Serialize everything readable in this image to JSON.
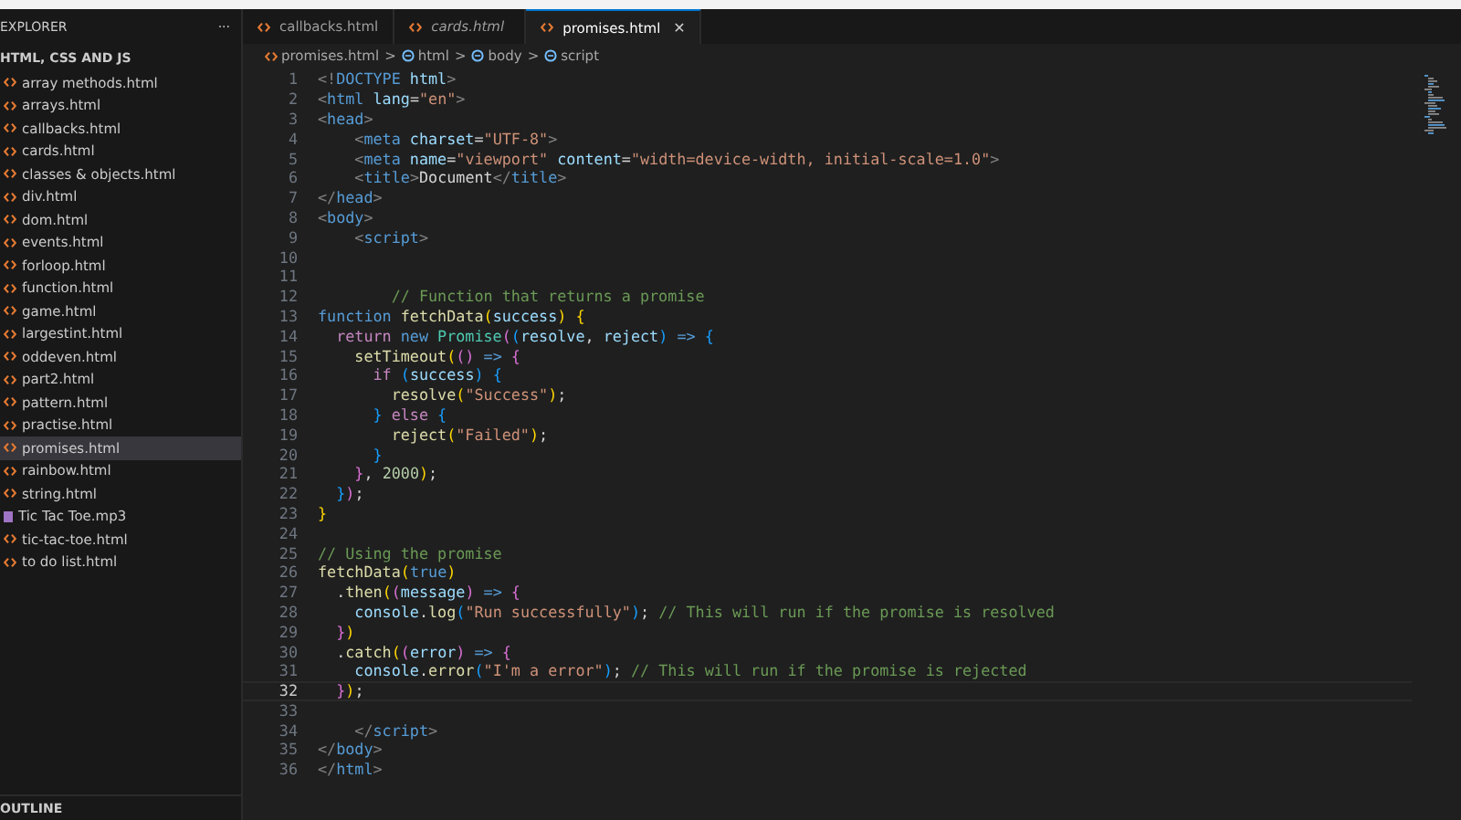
{
  "explorer": {
    "title": "EXPLORER",
    "more": "···",
    "folder": "HTML, CSS AND JS",
    "files": [
      {
        "name": "array methods.html",
        "kind": "html",
        "selected": false
      },
      {
        "name": "arrays.html",
        "kind": "html",
        "selected": false
      },
      {
        "name": "callbacks.html",
        "kind": "html",
        "selected": false
      },
      {
        "name": "cards.html",
        "kind": "html",
        "selected": false
      },
      {
        "name": "classes & objects.html",
        "kind": "html",
        "selected": false
      },
      {
        "name": "div.html",
        "kind": "html",
        "selected": false
      },
      {
        "name": "dom.html",
        "kind": "html",
        "selected": false
      },
      {
        "name": "events.html",
        "kind": "html",
        "selected": false
      },
      {
        "name": "forloop.html",
        "kind": "html",
        "selected": false
      },
      {
        "name": "function.html",
        "kind": "html",
        "selected": false
      },
      {
        "name": "game.html",
        "kind": "html",
        "selected": false
      },
      {
        "name": "largestint.html",
        "kind": "html",
        "selected": false
      },
      {
        "name": "oddeven.html",
        "kind": "html",
        "selected": false
      },
      {
        "name": "part2.html",
        "kind": "html",
        "selected": false
      },
      {
        "name": "pattern.html",
        "kind": "html",
        "selected": false
      },
      {
        "name": "practise.html",
        "kind": "html",
        "selected": false
      },
      {
        "name": "promises.html",
        "kind": "html",
        "selected": true
      },
      {
        "name": "rainbow.html",
        "kind": "html",
        "selected": false
      },
      {
        "name": "string.html",
        "kind": "html",
        "selected": false
      },
      {
        "name": "Tic Tac Toe.mp3",
        "kind": "audio",
        "selected": false
      },
      {
        "name": "tic-tac-toe.html",
        "kind": "html",
        "selected": false
      },
      {
        "name": "to do list.html",
        "kind": "html",
        "selected": false
      }
    ],
    "outline": "OUTLINE"
  },
  "tabs": [
    {
      "label": "callbacks.html",
      "selected": false,
      "preview": false
    },
    {
      "label": "cards.html",
      "selected": false,
      "preview": true
    },
    {
      "label": "promises.html",
      "selected": true,
      "preview": false,
      "close": "✕"
    }
  ],
  "breadcrumb": [
    {
      "label": "promises.html",
      "kind": "file"
    },
    {
      "label": "html",
      "kind": "element"
    },
    {
      "label": "body",
      "kind": "element"
    },
    {
      "label": "script",
      "kind": "element"
    }
  ],
  "breadcrumb_separator": ">",
  "code": [
    {
      "number": "1",
      "current": false,
      "tokens": [
        {
          "kind": "punct",
          "text": "<!"
        },
        {
          "kind": "tag",
          "text": "DOCTYPE"
        },
        {
          "kind": "attr",
          "text": " html"
        },
        {
          "kind": "punct",
          "text": ">"
        }
      ]
    },
    {
      "number": "2",
      "current": false,
      "tokens": [
        {
          "kind": "punct",
          "text": "<"
        },
        {
          "kind": "tag",
          "text": "html"
        },
        {
          "kind": "attr",
          "text": " lang"
        },
        {
          "kind": "text",
          "text": "="
        },
        {
          "kind": "str",
          "text": "\"en\""
        },
        {
          "kind": "punct",
          "text": ">"
        }
      ]
    },
    {
      "number": "3",
      "current": false,
      "tokens": [
        {
          "kind": "punct",
          "text": "<"
        },
        {
          "kind": "tag",
          "text": "head"
        },
        {
          "kind": "punct",
          "text": ">"
        }
      ]
    },
    {
      "number": "4",
      "current": false,
      "tokens": [
        {
          "kind": "punct",
          "text": "    <"
        },
        {
          "kind": "tag",
          "text": "meta"
        },
        {
          "kind": "attr",
          "text": " charset"
        },
        {
          "kind": "text",
          "text": "="
        },
        {
          "kind": "str",
          "text": "\"UTF-8\""
        },
        {
          "kind": "punct",
          "text": ">"
        }
      ]
    },
    {
      "number": "5",
      "current": false,
      "tokens": [
        {
          "kind": "punct",
          "text": "    <"
        },
        {
          "kind": "tag",
          "text": "meta"
        },
        {
          "kind": "attr",
          "text": " name"
        },
        {
          "kind": "text",
          "text": "="
        },
        {
          "kind": "str",
          "text": "\"viewport\""
        },
        {
          "kind": "attr",
          "text": " content"
        },
        {
          "kind": "text",
          "text": "="
        },
        {
          "kind": "str",
          "text": "\"width=device-width, initial-scale=1.0\""
        },
        {
          "kind": "punct",
          "text": ">"
        }
      ]
    },
    {
      "number": "6",
      "current": false,
      "tokens": [
        {
          "kind": "punct",
          "text": "    <"
        },
        {
          "kind": "tag",
          "text": "title"
        },
        {
          "kind": "punct",
          "text": ">"
        },
        {
          "kind": "text",
          "text": "Document"
        },
        {
          "kind": "punct",
          "text": "</"
        },
        {
          "kind": "tag",
          "text": "title"
        },
        {
          "kind": "punct",
          "text": ">"
        }
      ]
    },
    {
      "number": "7",
      "current": false,
      "tokens": [
        {
          "kind": "punct",
          "text": "</"
        },
        {
          "kind": "tag",
          "text": "head"
        },
        {
          "kind": "punct",
          "text": ">"
        }
      ]
    },
    {
      "number": "8",
      "current": false,
      "tokens": [
        {
          "kind": "punct",
          "text": "<"
        },
        {
          "kind": "tag",
          "text": "body"
        },
        {
          "kind": "punct",
          "text": ">"
        }
      ]
    },
    {
      "number": "9",
      "current": false,
      "tokens": [
        {
          "kind": "punct",
          "text": "    <"
        },
        {
          "kind": "tag",
          "text": "script"
        },
        {
          "kind": "punct",
          "text": ">"
        }
      ]
    },
    {
      "number": "10",
      "current": false
    },
    {
      "number": "11",
      "current": false
    },
    {
      "number": "12",
      "current": false,
      "tokens": [
        {
          "kind": "cmt",
          "text": "        // Function that returns a promise"
        }
      ]
    },
    {
      "number": "13",
      "current": false,
      "tokens": [
        {
          "kind": "kw",
          "text": "function"
        },
        {
          "kind": "fn",
          "text": " fetchData"
        },
        {
          "kind": "b1",
          "text": "("
        },
        {
          "kind": "var",
          "text": "success"
        },
        {
          "kind": "b1",
          "text": ") {"
        }
      ]
    },
    {
      "number": "14",
      "current": false,
      "tokens": [
        {
          "kind": "ctl",
          "text": "  return"
        },
        {
          "kind": "kw",
          "text": " new"
        },
        {
          "kind": "cls",
          "text": " Promise"
        },
        {
          "kind": "b2",
          "text": "("
        },
        {
          "kind": "b3",
          "text": "("
        },
        {
          "kind": "var",
          "text": "resolve"
        },
        {
          "kind": "text",
          "text": ", "
        },
        {
          "kind": "var",
          "text": "reject"
        },
        {
          "kind": "b3",
          "text": ")"
        },
        {
          "kind": "kw",
          "text": " =>"
        },
        {
          "kind": "b3",
          "text": " {"
        }
      ]
    },
    {
      "number": "15",
      "current": false,
      "tokens": [
        {
          "kind": "fn",
          "text": "    setTimeout"
        },
        {
          "kind": "b1",
          "text": "("
        },
        {
          "kind": "b2",
          "text": "()"
        },
        {
          "kind": "kw",
          "text": " =>"
        },
        {
          "kind": "b2",
          "text": " {"
        }
      ]
    },
    {
      "number": "16",
      "current": false,
      "tokens": [
        {
          "kind": "ctl",
          "text": "      if"
        },
        {
          "kind": "b3",
          "text": " ("
        },
        {
          "kind": "var",
          "text": "success"
        },
        {
          "kind": "b3",
          "text": ") {"
        }
      ]
    },
    {
      "number": "17",
      "current": false,
      "tokens": [
        {
          "kind": "fn",
          "text": "        resolve"
        },
        {
          "kind": "b1",
          "text": "("
        },
        {
          "kind": "str",
          "text": "\"Success\""
        },
        {
          "kind": "b1",
          "text": ")"
        },
        {
          "kind": "text",
          "text": ";"
        }
      ]
    },
    {
      "number": "18",
      "current": false,
      "tokens": [
        {
          "kind": "b3",
          "text": "      }"
        },
        {
          "kind": "ctl",
          "text": " else"
        },
        {
          "kind": "b3",
          "text": " {"
        }
      ]
    },
    {
      "number": "19",
      "current": false,
      "tokens": [
        {
          "kind": "fn",
          "text": "        reject"
        },
        {
          "kind": "b1",
          "text": "("
        },
        {
          "kind": "str",
          "text": "\"Failed\""
        },
        {
          "kind": "b1",
          "text": ")"
        },
        {
          "kind": "text",
          "text": ";"
        }
      ]
    },
    {
      "number": "20",
      "current": false,
      "tokens": [
        {
          "kind": "b3",
          "text": "      }"
        }
      ]
    },
    {
      "number": "21",
      "current": false,
      "tokens": [
        {
          "kind": "b2",
          "text": "    }"
        },
        {
          "kind": "text",
          "text": ", "
        },
        {
          "kind": "num",
          "text": "2000"
        },
        {
          "kind": "b1",
          "text": ")"
        },
        {
          "kind": "text",
          "text": ";"
        }
      ]
    },
    {
      "number": "22",
      "current": false,
      "tokens": [
        {
          "kind": "b3",
          "text": "  }"
        },
        {
          "kind": "b2",
          "text": ")"
        },
        {
          "kind": "text",
          "text": ";"
        }
      ]
    },
    {
      "number": "23",
      "current": false,
      "tokens": [
        {
          "kind": "b1",
          "text": "}"
        }
      ]
    },
    {
      "number": "24",
      "current": false
    },
    {
      "number": "25",
      "current": false,
      "tokens": [
        {
          "kind": "cmt",
          "text": "// Using the promise"
        }
      ]
    },
    {
      "number": "26",
      "current": false,
      "tokens": [
        {
          "kind": "fn",
          "text": "fetchData"
        },
        {
          "kind": "b1",
          "text": "("
        },
        {
          "kind": "kw",
          "text": "true"
        },
        {
          "kind": "b1",
          "text": ")"
        }
      ]
    },
    {
      "number": "27",
      "current": false,
      "tokens": [
        {
          "kind": "text",
          "text": "  ."
        },
        {
          "kind": "fn",
          "text": "then"
        },
        {
          "kind": "b1",
          "text": "("
        },
        {
          "kind": "b2",
          "text": "("
        },
        {
          "kind": "var",
          "text": "message"
        },
        {
          "kind": "b2",
          "text": ")"
        },
        {
          "kind": "kw",
          "text": " =>"
        },
        {
          "kind": "b2",
          "text": " {"
        }
      ]
    },
    {
      "number": "28",
      "current": false,
      "tokens": [
        {
          "kind": "var",
          "text": "    console"
        },
        {
          "kind": "text",
          "text": "."
        },
        {
          "kind": "fn",
          "text": "log"
        },
        {
          "kind": "b3",
          "text": "("
        },
        {
          "kind": "str",
          "text": "\"Run successfully\""
        },
        {
          "kind": "b3",
          "text": ")"
        },
        {
          "kind": "text",
          "text": "; "
        },
        {
          "kind": "cmt",
          "text": "// This will run if the promise is resolved"
        }
      ]
    },
    {
      "number": "29",
      "current": false,
      "tokens": [
        {
          "kind": "b2",
          "text": "  }"
        },
        {
          "kind": "b1",
          "text": ")"
        }
      ]
    },
    {
      "number": "30",
      "current": false,
      "tokens": [
        {
          "kind": "text",
          "text": "  ."
        },
        {
          "kind": "fn",
          "text": "catch"
        },
        {
          "kind": "b1",
          "text": "("
        },
        {
          "kind": "b2",
          "text": "("
        },
        {
          "kind": "var",
          "text": "error"
        },
        {
          "kind": "b2",
          "text": ")"
        },
        {
          "kind": "kw",
          "text": " =>"
        },
        {
          "kind": "b2",
          "text": " {"
        }
      ]
    },
    {
      "number": "31",
      "current": false,
      "tokens": [
        {
          "kind": "var",
          "text": "    console"
        },
        {
          "kind": "text",
          "text": "."
        },
        {
          "kind": "fn",
          "text": "error"
        },
        {
          "kind": "b3",
          "text": "("
        },
        {
          "kind": "str",
          "text": "\"I'm a error\""
        },
        {
          "kind": "b3",
          "text": ")"
        },
        {
          "kind": "text",
          "text": "; "
        },
        {
          "kind": "cmt",
          "text": "// This will run if the promise is rejected"
        }
      ]
    },
    {
      "number": "32",
      "current": true,
      "tokens": [
        {
          "kind": "b2",
          "text": "  }"
        },
        {
          "kind": "b1",
          "text": ")"
        },
        {
          "kind": "text",
          "text": ";"
        }
      ]
    },
    {
      "number": "33",
      "current": false
    },
    {
      "number": "34",
      "current": false,
      "tokens": [
        {
          "kind": "punct",
          "text": "    </"
        },
        {
          "kind": "tag",
          "text": "script"
        },
        {
          "kind": "punct",
          "text": ">"
        }
      ]
    },
    {
      "number": "35",
      "current": false,
      "tokens": [
        {
          "kind": "punct",
          "text": "</"
        },
        {
          "kind": "tag",
          "text": "body"
        },
        {
          "kind": "punct",
          "text": ">"
        }
      ]
    },
    {
      "number": "36",
      "current": false,
      "tokens": [
        {
          "kind": "punct",
          "text": "</"
        },
        {
          "kind": "tag",
          "text": "html"
        },
        {
          "kind": "punct",
          "text": ">"
        }
      ]
    }
  ]
}
